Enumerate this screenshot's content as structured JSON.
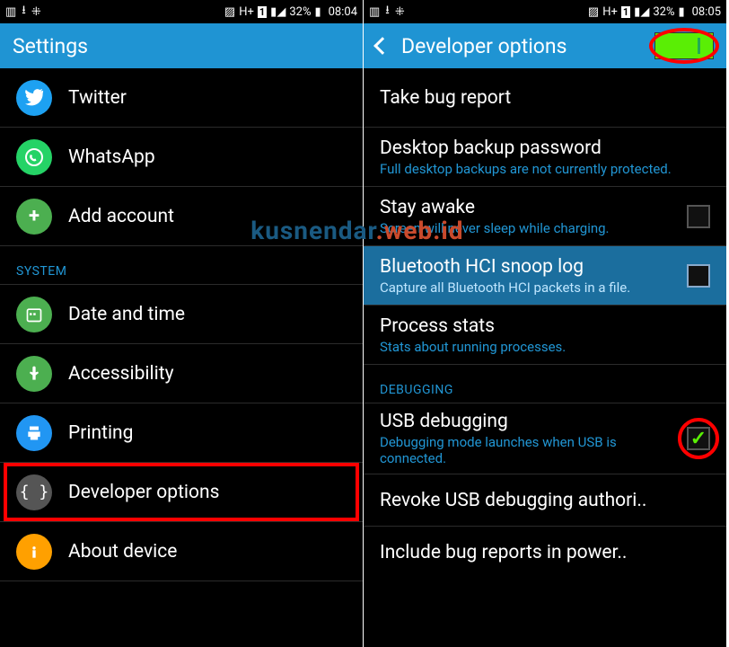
{
  "left": {
    "status": {
      "battery": "32%",
      "clock": "08:04"
    },
    "title": "Settings",
    "items": [
      {
        "label": "Twitter"
      },
      {
        "label": "WhatsApp"
      },
      {
        "label": "Add account"
      }
    ],
    "section": "SYSTEM",
    "system_items": [
      {
        "label": "Date and time"
      },
      {
        "label": "Accessibility"
      },
      {
        "label": "Printing"
      },
      {
        "label": "Developer options"
      },
      {
        "label": "About device"
      }
    ]
  },
  "right": {
    "status": {
      "battery": "32%",
      "clock": "08:05"
    },
    "title": "Developer options",
    "toggle_on": true,
    "items": [
      {
        "title": "Take bug report"
      },
      {
        "title": "Desktop backup password",
        "sub": "Full desktop backups are not currently protected."
      },
      {
        "title": "Stay awake",
        "sub": "Screen will never sleep while charging.",
        "checkbox": false
      },
      {
        "title": "Bluetooth HCI snoop log",
        "sub": "Capture all Bluetooth HCI packets in a file.",
        "checkbox": false,
        "highlight": true
      },
      {
        "title": "Process stats",
        "sub": "Stats about running processes."
      }
    ],
    "section": "DEBUGGING",
    "debug_items": [
      {
        "title": "USB debugging",
        "sub": "Debugging mode launches when USB is connected.",
        "checkbox": true
      },
      {
        "title": "Revoke USB debugging authori.."
      },
      {
        "title": "Include bug reports in power.."
      }
    ]
  },
  "watermark": {
    "a": "kusnendar",
    "b": ".web.id"
  }
}
